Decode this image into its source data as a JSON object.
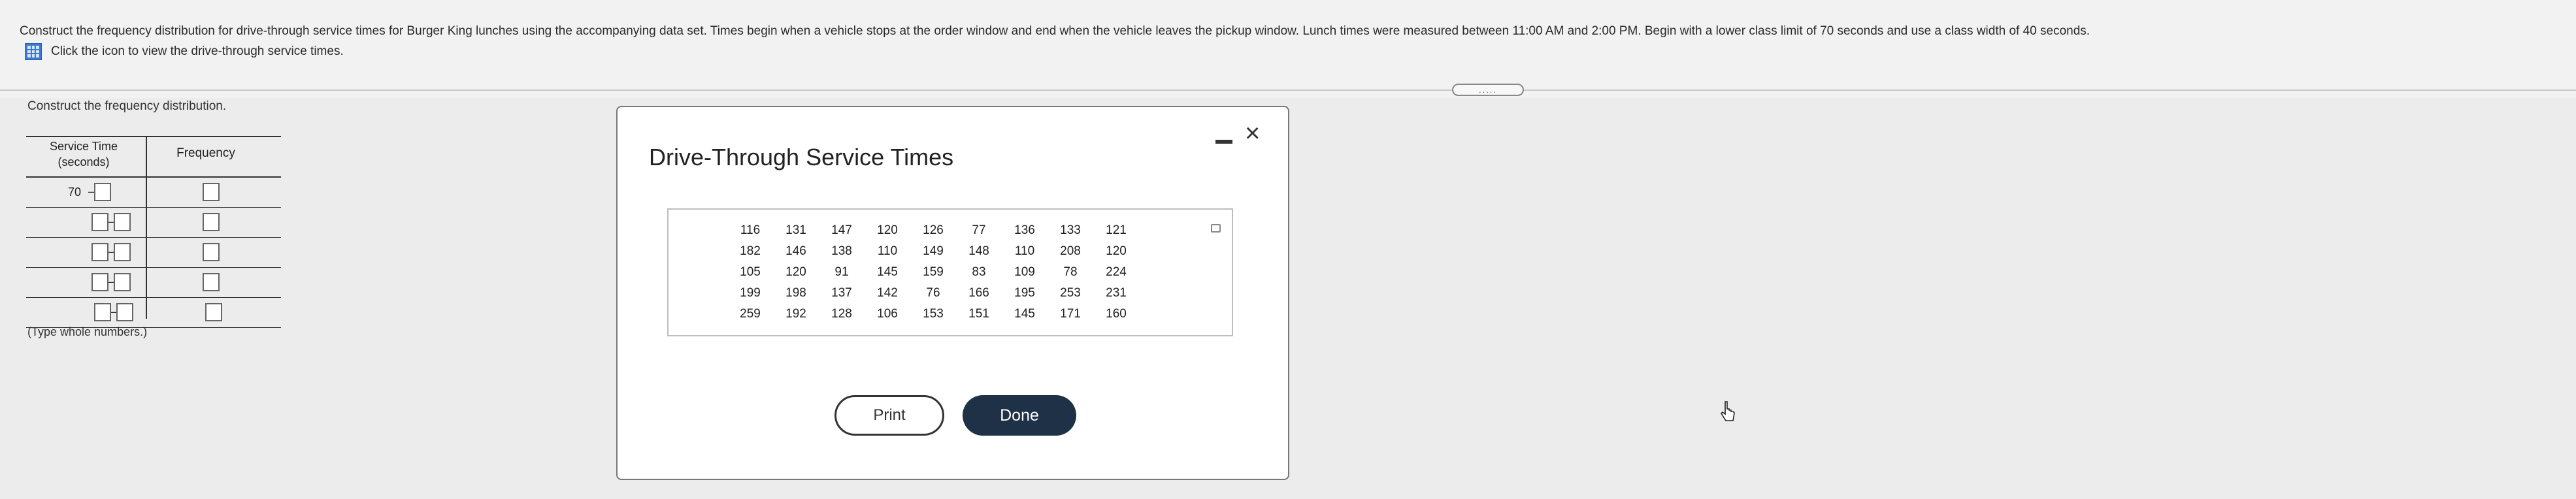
{
  "header": {
    "instructions": "Construct the frequency distribution for drive-through service times for Burger King lunches using the accompanying data set. Times begin when a vehicle stops at the order window and end when the vehicle leaves the pickup window. Lunch times were measured between 11:00 AM and 2:00 PM. Begin with a lower class limit of 70 seconds and use a class width of 40 seconds.",
    "icon_link": "Click the icon to view the drive-through service times.",
    "more_indicator": "....."
  },
  "left_panel": {
    "label": "Construct the frequency distribution.",
    "col1_line1": "Service Time",
    "col1_line2": "(seconds)",
    "col2": "Frequency",
    "first_class_lower": "70",
    "hint": "(Type whole numbers.)"
  },
  "modal": {
    "title": "Drive-Through Service Times",
    "minimize": "−",
    "close": "×",
    "data_rows": [
      [
        "116",
        "131",
        "147",
        "120",
        "126",
        "77",
        "136",
        "133",
        "121"
      ],
      [
        "182",
        "146",
        "138",
        "110",
        "149",
        "148",
        "110",
        "208",
        "120"
      ],
      [
        "105",
        "120",
        "91",
        "145",
        "159",
        "83",
        "109",
        "78",
        "224"
      ],
      [
        "199",
        "198",
        "137",
        "142",
        "76",
        "166",
        "195",
        "253",
        "231"
      ],
      [
        "259",
        "192",
        "128",
        "106",
        "153",
        "151",
        "145",
        "171",
        "160"
      ]
    ],
    "print_label": "Print",
    "done_label": "Done"
  }
}
